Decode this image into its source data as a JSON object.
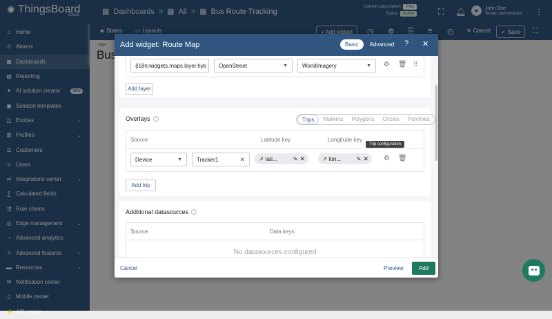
{
  "app": {
    "name": "ThingsBoard",
    "sub": "Cloud"
  },
  "breadcrumb": {
    "items": [
      "Dashboards",
      "All",
      "Bus Route Tracking"
    ],
    "sep": ">"
  },
  "subscription": {
    "label": "Current subscription",
    "plan": "Pilot",
    "status_label": "Status",
    "status": "Active"
  },
  "user": {
    "name": "John Doe",
    "role": "Tenant administrator"
  },
  "sidebar": {
    "items": [
      {
        "label": "Home",
        "icon": "home-icon"
      },
      {
        "label": "Alarms",
        "icon": "alarm-icon"
      },
      {
        "label": "Dashboards",
        "icon": "dashboard-icon",
        "active": true
      },
      {
        "label": "Reporting",
        "icon": "report-icon"
      },
      {
        "label": "AI solution creator",
        "icon": "ai-icon",
        "badge": "NEW"
      },
      {
        "label": "Solution templates",
        "icon": "template-icon"
      },
      {
        "label": "Entities",
        "icon": "entities-icon",
        "expand": true
      },
      {
        "label": "Profiles",
        "icon": "profiles-icon",
        "expand": true
      },
      {
        "label": "Customers",
        "icon": "customers-icon"
      },
      {
        "label": "Users",
        "icon": "users-icon"
      },
      {
        "label": "Integrations center",
        "icon": "integrations-icon",
        "expand": true
      },
      {
        "label": "Calculated fields",
        "icon": "calc-icon"
      },
      {
        "label": "Rule chains",
        "icon": "rule-chains-icon"
      },
      {
        "label": "Edge management",
        "icon": "edge-icon",
        "expand": true
      },
      {
        "label": "Advanced analytics",
        "icon": "analytics-icon"
      },
      {
        "label": "Advanced features",
        "icon": "features-icon",
        "expand": true
      },
      {
        "label": "Resources",
        "icon": "resources-icon",
        "expand": true
      },
      {
        "label": "Notification center",
        "icon": "notification-icon"
      },
      {
        "label": "Mobile center",
        "icon": "mobile-icon"
      },
      {
        "label": "API usage",
        "icon": "api-icon"
      }
    ]
  },
  "toolbar": {
    "states": "States",
    "layouts": "Layouts",
    "add_widget": "+ Add widget",
    "cancel": "Cancel",
    "save": "Save"
  },
  "dashboard": {
    "title_label": "Title*",
    "title": "Bus"
  },
  "dialog": {
    "title": "Add widget:",
    "widget_name": "Route Map",
    "mode_basic": "Basic",
    "mode_advanced": "Advanced",
    "layer": {
      "label": "{i18n:widgets.maps.layer.hyb",
      "provider": "OpenStreet",
      "type": "WorldImagery"
    },
    "add_layer": "Add layer",
    "overlays": {
      "title": "Overlays",
      "tabs": [
        "Trips",
        "Markers",
        "Polygons",
        "Circles",
        "Polylines"
      ],
      "active_tab": "Trips",
      "columns": [
        "Source",
        "Latitude key",
        "Longitude key"
      ],
      "row": {
        "source_type": "Device",
        "entity": "Tracker1",
        "lat": "lati...",
        "lon": "lon..."
      },
      "tooltip": "Trip configuration",
      "add_trip": "Add trip"
    },
    "additional": {
      "title": "Additional datasources",
      "columns": [
        "Source",
        "Data keys"
      ],
      "empty": "No datasources configured"
    },
    "footer": {
      "cancel": "Cancel",
      "preview": "Preview",
      "add": "Add"
    }
  }
}
